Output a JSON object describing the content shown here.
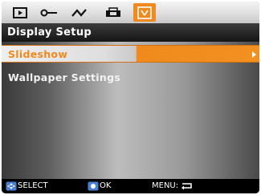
{
  "tabs": [
    {
      "icon": "playback-icon",
      "active": false
    },
    {
      "icon": "key-icon",
      "active": false
    },
    {
      "icon": "wave-icon",
      "active": false
    },
    {
      "icon": "print-icon",
      "active": false
    },
    {
      "icon": "display-setup-icon",
      "active": true
    }
  ],
  "header": {
    "title": "Display Setup"
  },
  "menu": {
    "items": [
      {
        "label": "Slideshow",
        "selected": true
      },
      {
        "label": "Wallpaper Settings",
        "selected": false
      }
    ]
  },
  "footer": {
    "select_label": "SELECT",
    "ok_label": "OK",
    "menu_label": "MENU:"
  },
  "colors": {
    "accent": "#f08a1e",
    "header_bg": "#151515",
    "footer_bg": "#000000"
  }
}
